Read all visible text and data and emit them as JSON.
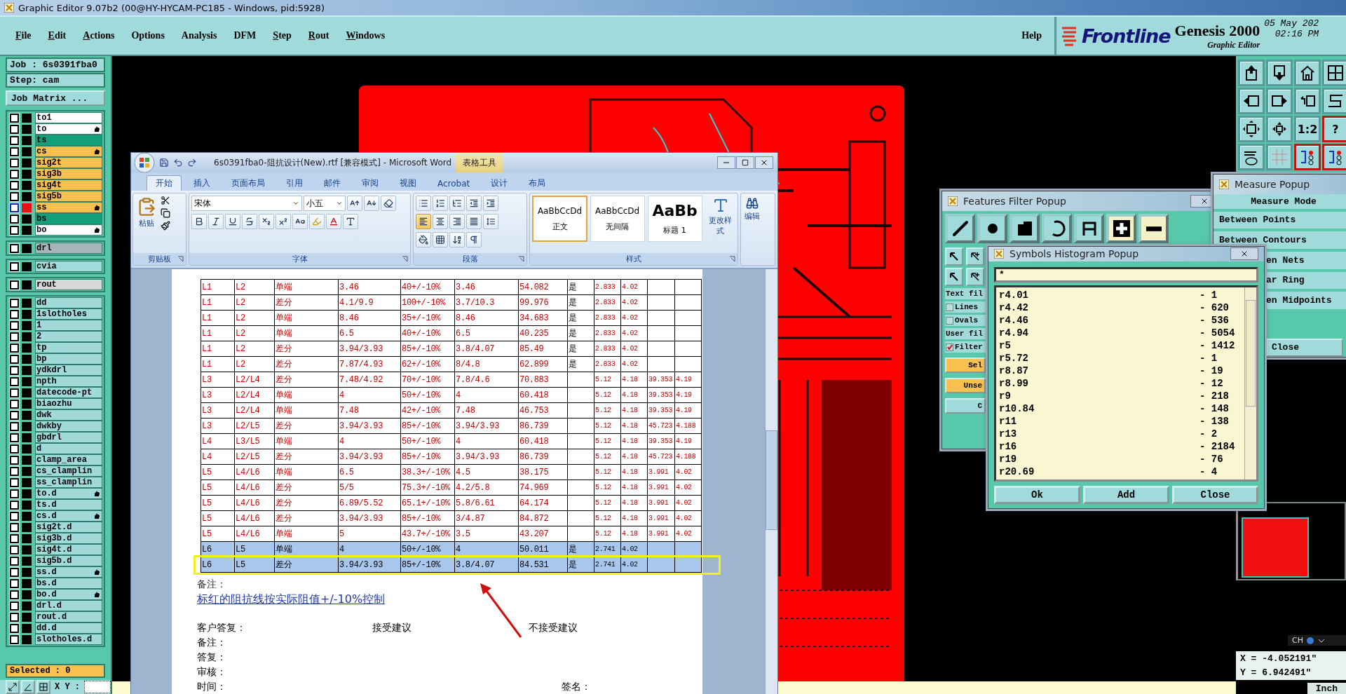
{
  "window": {
    "title": "Graphic Editor 9.07b2 (00@HY-HYCAM-PC185 - Windows, pid:5928)"
  },
  "menu": [
    {
      "label": "File",
      "mnemonic": true
    },
    {
      "label": "Edit",
      "mnemonic": true
    },
    {
      "label": "Actions",
      "mnemonic": true
    },
    {
      "label": "Options",
      "mnemonic": false
    },
    {
      "label": "Analysis",
      "mnemonic": false
    },
    {
      "label": "DFM",
      "mnemonic": false
    },
    {
      "label": "Step",
      "mnemonic": true
    },
    {
      "label": "Rout",
      "mnemonic": true
    },
    {
      "label": "Windows",
      "mnemonic": true
    }
  ],
  "help": "Help",
  "brand": {
    "logo": "Frontline",
    "product": "Genesis 2000",
    "subtitle": "Graphic Editor",
    "date": "05 May 202",
    "time": "02:16 PM"
  },
  "job": {
    "job": "Job : 6s0391fba0",
    "step": "Step: cam",
    "matrix_button": "Job Matrix ..."
  },
  "layer_groups": [
    [
      {
        "name": "to1",
        "color": "#ffffff",
        "affected": false,
        "work": false,
        "checked": false
      },
      {
        "name": "to",
        "color": "#ffffff",
        "affected": true,
        "work": false,
        "checked": false
      },
      {
        "name": "ts",
        "color": "#12a07a",
        "affected": false,
        "work": false,
        "checked": false
      },
      {
        "name": "cs",
        "color": "#f8c050",
        "affected": true,
        "work": false,
        "checked": false
      },
      {
        "name": "sig2t",
        "color": "#f8c050",
        "affected": false,
        "work": false,
        "checked": false
      },
      {
        "name": "sig3b",
        "color": "#f8c050",
        "affected": false,
        "work": false,
        "checked": false
      },
      {
        "name": "sig4t",
        "color": "#f8c050",
        "affected": false,
        "work": false,
        "checked": false
      },
      {
        "name": "sig5b",
        "color": "#f8c050",
        "affected": false,
        "work": false,
        "checked": false
      },
      {
        "name": "ss",
        "color": "#f8c050",
        "affected": true,
        "work": true,
        "checked": false
      },
      {
        "name": "bs",
        "color": "#12a07a",
        "affected": false,
        "work": false,
        "checked": false
      },
      {
        "name": "bo",
        "color": "#ffffff",
        "affected": true,
        "work": false,
        "checked": false
      }
    ],
    [
      {
        "name": "drl",
        "color": "#a8b6ba",
        "affected": false,
        "work": false,
        "checked": false
      }
    ],
    [
      {
        "name": "cvia",
        "color": "#a0dada",
        "affected": false,
        "work": false,
        "checked": false
      }
    ],
    [
      {
        "name": "rout",
        "color": "#d8d8d8",
        "affected": false,
        "work": false,
        "checked": false
      }
    ],
    [
      {
        "name": "dd",
        "color": "#a0dada",
        "affected": false,
        "work": false,
        "checked": false
      },
      {
        "name": "1slotholes",
        "color": "#a0dada",
        "affected": false,
        "work": false,
        "checked": false
      },
      {
        "name": "1",
        "color": "#a0dada",
        "affected": false,
        "work": false,
        "checked": false
      },
      {
        "name": "2",
        "color": "#a0dada",
        "affected": false,
        "work": false,
        "checked": false
      },
      {
        "name": "tp",
        "color": "#a0dada",
        "affected": false,
        "work": false,
        "checked": false
      },
      {
        "name": "bp",
        "color": "#a0dada",
        "affected": false,
        "work": false,
        "checked": false
      },
      {
        "name": "ydkdrl",
        "color": "#a0dada",
        "affected": false,
        "work": false,
        "checked": false
      },
      {
        "name": "npth",
        "color": "#a0dada",
        "affected": false,
        "work": false,
        "checked": false
      },
      {
        "name": "datecode-pt",
        "color": "#a0dada",
        "affected": false,
        "work": false,
        "checked": false
      },
      {
        "name": "biaozhu",
        "color": "#a0dada",
        "affected": false,
        "work": false,
        "checked": false
      },
      {
        "name": "dwk",
        "color": "#a0dada",
        "affected": false,
        "work": false,
        "checked": false
      },
      {
        "name": "dwkby",
        "color": "#a0dada",
        "affected": false,
        "work": false,
        "checked": false
      },
      {
        "name": "gbdrl",
        "color": "#a0dada",
        "affected": false,
        "work": false,
        "checked": false
      },
      {
        "name": "d",
        "color": "#a0dada",
        "affected": false,
        "work": false,
        "checked": false
      },
      {
        "name": "clamp_area",
        "color": "#a0dada",
        "affected": false,
        "work": false,
        "checked": false
      },
      {
        "name": "cs_clamplin",
        "color": "#a0dada",
        "affected": false,
        "work": false,
        "checked": false
      },
      {
        "name": "ss_clamplin",
        "color": "#a0dada",
        "affected": false,
        "work": false,
        "checked": false
      },
      {
        "name": "to.d",
        "color": "#a0dada",
        "affected": true,
        "work": false,
        "checked": false
      },
      {
        "name": "ts.d",
        "color": "#a0dada",
        "affected": false,
        "work": false,
        "checked": false
      },
      {
        "name": "cs.d",
        "color": "#a0dada",
        "affected": true,
        "work": false,
        "checked": false
      },
      {
        "name": "sig2t.d",
        "color": "#a0dada",
        "affected": false,
        "work": false,
        "checked": false
      },
      {
        "name": "sig3b.d",
        "color": "#a0dada",
        "affected": false,
        "work": false,
        "checked": false
      },
      {
        "name": "sig4t.d",
        "color": "#a0dada",
        "affected": false,
        "work": false,
        "checked": false
      },
      {
        "name": "sig5b.d",
        "color": "#a0dada",
        "affected": false,
        "work": false,
        "checked": false
      },
      {
        "name": "ss.d",
        "color": "#a0dada",
        "affected": true,
        "work": false,
        "checked": false
      },
      {
        "name": "bs.d",
        "color": "#a0dada",
        "affected": false,
        "work": false,
        "checked": false
      },
      {
        "name": "bo.d",
        "color": "#a0dada",
        "affected": true,
        "work": false,
        "checked": false
      },
      {
        "name": "drl.d",
        "color": "#a0dada",
        "affected": false,
        "work": false,
        "checked": false
      },
      {
        "name": "rout.d",
        "color": "#a0dada",
        "affected": false,
        "work": false,
        "checked": false
      },
      {
        "name": "dd.d",
        "color": "#a0dada",
        "affected": false,
        "work": false,
        "checked": false
      },
      {
        "name": "slotholes.d",
        "color": "#a0dada",
        "affected": false,
        "work": false,
        "checked": false
      }
    ]
  ],
  "selected_count": "Selected : 0",
  "xy_label": "X Y :",
  "view_tools": [
    {
      "kind": "up",
      "highlighted": false
    },
    {
      "kind": "down",
      "highlighted": false
    },
    {
      "kind": "home",
      "highlighted": false
    },
    {
      "kind": "window",
      "highlighted": false
    },
    {
      "kind": "left",
      "highlighted": false
    },
    {
      "kind": "right",
      "highlighted": false
    },
    {
      "kind": "undo",
      "highlighted": false
    },
    {
      "kind": "route",
      "highlighted": false
    },
    {
      "kind": "fit",
      "highlighted": false
    },
    {
      "kind": "center",
      "highlighted": false
    },
    {
      "kind": "label",
      "label": "1:2",
      "highlighted": false
    },
    {
      "kind": "label",
      "label": "?",
      "highlighted": true
    },
    {
      "kind": "tools",
      "highlighted": false
    },
    {
      "kind": "grid",
      "highlighted": false
    },
    {
      "kind": "net",
      "highlighted": true
    },
    {
      "kind": "net",
      "highlighted": true
    }
  ],
  "word": {
    "title": "6s0391fba0-阻抗设计(New).rtf [兼容模式] - Microsoft Word",
    "context_tab": "表格工具",
    "tabs": [
      {
        "label": "开始",
        "selected": true
      },
      {
        "label": "插入",
        "selected": false
      },
      {
        "label": "页面布局",
        "selected": false
      },
      {
        "label": "引用",
        "selected": false
      },
      {
        "label": "邮件",
        "selected": false
      },
      {
        "label": "审阅",
        "selected": false
      },
      {
        "label": "视图",
        "selected": false
      },
      {
        "label": "Acrobat",
        "selected": false
      },
      {
        "label": "设计",
        "selected": false
      },
      {
        "label": "布局",
        "selected": false
      }
    ],
    "ribbon": {
      "paste": "粘贴",
      "clipboard_label": "剪贴板",
      "font_name": "宋体",
      "font_size": "小五",
      "font_label": "字体",
      "paragraph_label": "段落",
      "styles": [
        {
          "sample": "AaBbCcDd",
          "name": "正文",
          "selected": true
        },
        {
          "sample": "AaBbCcDd",
          "name": "无间隔",
          "selected": false
        },
        {
          "sample": "AaBb",
          "name": "标题 1",
          "selected": false
        }
      ],
      "change_styles": "更改样式",
      "styles_label": "样式",
      "editing": "编辑"
    },
    "table": {
      "rows": [
        {
          "selected": false,
          "annotated": false,
          "cells": [
            "L1",
            "L2",
            "单端",
            "3.46",
            "40+/-10%",
            "3.46",
            "54.082",
            "是",
            "2.833",
            "4.02",
            "",
            ""
          ]
        },
        {
          "selected": false,
          "annotated": false,
          "cells": [
            "L1",
            "L2",
            "差分",
            "4.1/9.9",
            "100+/-10%",
            "3.7/10.3",
            "99.976",
            "是",
            "2.833",
            "4.02",
            "",
            ""
          ]
        },
        {
          "selected": false,
          "annotated": false,
          "cells": [
            "L1",
            "L2",
            "单端",
            "8.46",
            "35+/-10%",
            "8.46",
            "34.683",
            "是",
            "2.833",
            "4.02",
            "",
            ""
          ]
        },
        {
          "selected": false,
          "annotated": false,
          "cells": [
            "L1",
            "L2",
            "单端",
            "6.5",
            "40+/-10%",
            "6.5",
            "40.235",
            "是",
            "2.833",
            "4.02",
            "",
            ""
          ]
        },
        {
          "selected": false,
          "annotated": false,
          "cells": [
            "L1",
            "L2",
            "差分",
            "3.94/3.93",
            "85+/-10%",
            "3.8/4.07",
            "85.49",
            "是",
            "2.833",
            "4.02",
            "",
            ""
          ]
        },
        {
          "selected": false,
          "annotated": false,
          "cells": [
            "L1",
            "L2",
            "差分",
            "7.87/4.93",
            "62+/-10%",
            "8/4.8",
            "62.899",
            "是",
            "2.833",
            "4.02",
            "",
            ""
          ]
        },
        {
          "selected": false,
          "annotated": false,
          "cells": [
            "L3",
            "L2/L4",
            "差分",
            "7.48/4.92",
            "70+/-10%",
            "7.8/4.6",
            "70.883",
            "",
            "5.12",
            "4.18",
            "39.353",
            "4.19"
          ]
        },
        {
          "selected": false,
          "annotated": false,
          "cells": [
            "L3",
            "L2/L4",
            "单端",
            "4",
            "50+/-10%",
            "4",
            "60.418",
            "",
            "5.12",
            "4.18",
            "39.353",
            "4.19"
          ]
        },
        {
          "selected": false,
          "annotated": false,
          "cells": [
            "L3",
            "L2/L4",
            "单端",
            "7.48",
            "42+/-10%",
            "7.48",
            "46.753",
            "",
            "5.12",
            "4.18",
            "39.353",
            "4.19"
          ]
        },
        {
          "selected": false,
          "annotated": false,
          "cells": [
            "L3",
            "L2/L5",
            "差分",
            "3.94/3.93",
            "85+/-10%",
            "3.94/3.93",
            "86.739",
            "",
            "5.12",
            "4.18",
            "45.723",
            "4.188"
          ]
        },
        {
          "selected": false,
          "annotated": false,
          "cells": [
            "L4",
            "L3/L5",
            "单端",
            "4",
            "50+/-10%",
            "4",
            "60.418",
            "",
            "5.12",
            "4.18",
            "39.353",
            "4.19"
          ]
        },
        {
          "selected": false,
          "annotated": false,
          "cells": [
            "L4",
            "L2/L5",
            "差分",
            "3.94/3.93",
            "85+/-10%",
            "3.94/3.93",
            "86.739",
            "",
            "5.12",
            "4.18",
            "45.723",
            "4.188"
          ]
        },
        {
          "selected": false,
          "annotated": false,
          "cells": [
            "L5",
            "L4/L6",
            "单端",
            "6.5",
            "38.3+/-10%",
            "4.5",
            "38.175",
            "",
            "5.12",
            "4.18",
            "3.991",
            "4.02"
          ]
        },
        {
          "selected": false,
          "annotated": false,
          "cells": [
            "L5",
            "L4/L6",
            "差分",
            "5/5",
            "75.3+/-10%",
            "4.2/5.8",
            "74.969",
            "",
            "5.12",
            "4.18",
            "3.991",
            "4.02"
          ]
        },
        {
          "selected": false,
          "annotated": false,
          "cells": [
            "L5",
            "L4/L6",
            "差分",
            "6.89/5.52",
            "65.1+/-10%",
            "5.8/6.61",
            "64.174",
            "",
            "5.12",
            "4.18",
            "3.991",
            "4.02"
          ]
        },
        {
          "selected": false,
          "annotated": false,
          "cells": [
            "L5",
            "L4/L6",
            "差分",
            "3.94/3.93",
            "85+/-10%",
            "3/4.87",
            "84.872",
            "",
            "5.12",
            "4.18",
            "3.991",
            "4.02"
          ]
        },
        {
          "selected": false,
          "annotated": false,
          "cells": [
            "L5",
            "L4/L6",
            "单端",
            "5",
            "43.7+/-10%",
            "3.5",
            "43.207",
            "",
            "5.12",
            "4.18",
            "3.991",
            "4.02"
          ]
        },
        {
          "selected": true,
          "annotated": false,
          "cells": [
            "L6",
            "L5",
            "单端",
            "4",
            "50+/-10%",
            "4",
            "50.011",
            "是",
            "2.741",
            "4.02",
            "",
            ""
          ]
        },
        {
          "selected": true,
          "annotated": true,
          "cells": [
            "L6",
            "L5",
            "差分",
            "3.94/3.93",
            "85+/-10%",
            "3.8/4.07",
            "84.531",
            "是",
            "2.741",
            "4.02",
            "",
            ""
          ]
        }
      ]
    },
    "note_label": "备注：",
    "note": "标红的阻抗线按实际阻值+/-10%控制",
    "reply": {
      "label": "客户答复：",
      "accept": "接受建议",
      "reject": "不接受建议"
    },
    "fields": [
      "备注：",
      "答复：",
      "审核：",
      "时间："
    ],
    "signature": "签名："
  },
  "features_filter": {
    "title": "Features Filter Popup",
    "types": [
      {
        "kind": "line",
        "on": false
      },
      {
        "kind": "pad",
        "on": false
      },
      {
        "kind": "surface",
        "on": false
      },
      {
        "kind": "arc",
        "on": false
      },
      {
        "kind": "text",
        "on": false
      },
      {
        "kind": "positive",
        "on": true
      },
      {
        "kind": "negative",
        "on": true
      }
    ],
    "text_filter": "Text fil",
    "checks": [
      {
        "label": "Lines",
        "checked": false
      },
      {
        "label": "Ovals",
        "checked": false
      }
    ],
    "user_filter": "User fil",
    "filter": {
      "label": "Filter",
      "checked": true
    },
    "buttons": [
      {
        "label": "Sel",
        "kind": "action"
      },
      {
        "label": "Unse",
        "kind": "action"
      },
      {
        "label": "C",
        "kind": "plain"
      }
    ]
  },
  "histogram": {
    "title": "Symbols Histogram Popup",
    "filter": "*",
    "rows": [
      {
        "symbol": "r4.01",
        "count": "- 1"
      },
      {
        "symbol": "r4.42",
        "count": "- 620"
      },
      {
        "symbol": "r4.46",
        "count": "- 536"
      },
      {
        "symbol": "r4.94",
        "count": "- 5054"
      },
      {
        "symbol": "r5",
        "count": "- 1412"
      },
      {
        "symbol": "r5.72",
        "count": "- 1"
      },
      {
        "symbol": "r8.87",
        "count": "- 19"
      },
      {
        "symbol": "r8.99",
        "count": "- 12"
      },
      {
        "symbol": "r9",
        "count": "- 218"
      },
      {
        "symbol": "r10.84",
        "count": "- 148"
      },
      {
        "symbol": "r11",
        "count": "- 138"
      },
      {
        "symbol": "r13",
        "count": "- 2"
      },
      {
        "symbol": "r16",
        "count": "- 2184"
      },
      {
        "symbol": "r19",
        "count": "- 76"
      },
      {
        "symbol": "r20.69",
        "count": "- 4"
      }
    ],
    "buttons": [
      "Ok",
      "Add",
      "Close"
    ]
  },
  "measure": {
    "title": "Measure Popup",
    "heading": "Measure Mode",
    "modes": [
      "Between Points",
      "Between Contours",
      "en Nets",
      "ar Ring",
      "en Midpoints"
    ],
    "close": "Close"
  },
  "readout": {
    "x": "X = -4.052191\"",
    "y": "Y = 6.942491\"",
    "units": "Inch",
    "ime": "CH"
  }
}
